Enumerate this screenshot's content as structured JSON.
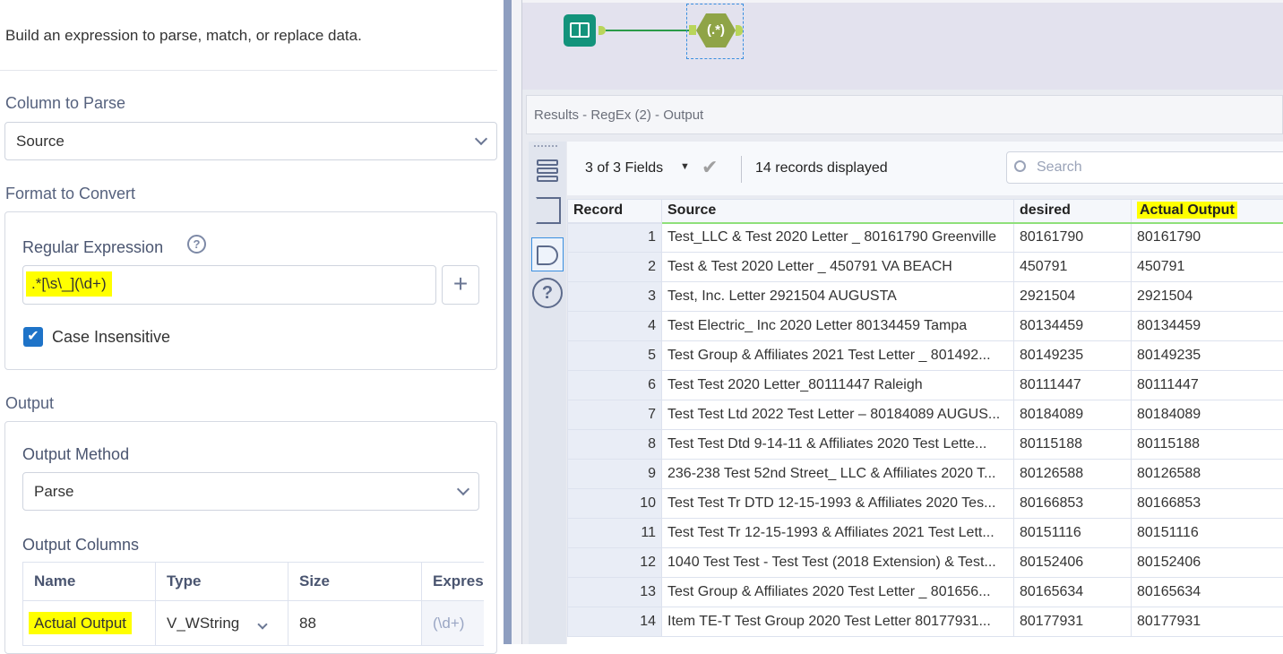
{
  "config": {
    "description": "Build an expression to parse, match, or replace data.",
    "column_to_parse_label": "Column to Parse",
    "column_to_parse_value": "Source",
    "format_label": "Format to Convert",
    "regex_label": "Regular Expression",
    "regex_value": ".*[\\s\\_](\\d+)",
    "plus_label": "+",
    "case_insensitive_label": "Case Insensitive",
    "case_insensitive_checked": true,
    "output_label": "Output",
    "output_method_label": "Output Method",
    "output_method_value": "Parse",
    "output_columns_label": "Output Columns",
    "output_columns_headers": [
      "Name",
      "Type",
      "Size",
      "Expres"
    ],
    "output_columns_rows": [
      {
        "name": "Actual Output",
        "type": "V_WString",
        "size": "88",
        "expr": "(\\d+)"
      }
    ]
  },
  "workflow": {
    "tool_regex_label": "(.*)"
  },
  "results": {
    "title": "Results - RegEx (2) - Output",
    "fields_label": "3 of 3 Fields",
    "records_label": "14 records displayed",
    "search_placeholder": "Search",
    "headers": [
      "Record",
      "Source",
      "desired",
      "Actual Output"
    ],
    "rows": [
      [
        "1",
        "Test_LLC & Test 2020 Letter _ 80161790 Greenville",
        "80161790",
        "80161790"
      ],
      [
        "2",
        "Test & Test 2020 Letter _ 450791 VA BEACH",
        "450791",
        "450791"
      ],
      [
        "3",
        "Test, Inc. Letter 2921504 AUGUSTA",
        "2921504",
        "2921504"
      ],
      [
        "4",
        "Test Electric_ Inc 2020 Letter 80134459 Tampa",
        "80134459",
        "80134459"
      ],
      [
        "5",
        "Test Group & Affiliates 2021 Test Letter _  801492...",
        "80149235",
        "80149235"
      ],
      [
        "6",
        "Test Test 2020 Letter_80111447 Raleigh",
        "80111447",
        "80111447"
      ],
      [
        "7",
        "Test Test Ltd 2022 Test Letter – 80184089 AUGUS...",
        "80184089",
        "80184089"
      ],
      [
        "8",
        "Test Test Dtd 9-14-11 & Affiliates 2020 Test Lette...",
        "80115188",
        "80115188"
      ],
      [
        "9",
        "236-238 Test 52nd Street_ LLC & Affiliates 2020 T...",
        "80126588",
        "80126588"
      ],
      [
        "10",
        "Test Test Tr DTD 12-15-1993 & Affiliates 2020 Tes...",
        "80166853",
        "80166853"
      ],
      [
        "11",
        "Test Test Tr 12-15-1993 & Affiliates 2021 Test Lett...",
        "80151116",
        "80151116"
      ],
      [
        "12",
        "1040 Test Test - Test Test (2018 Extension) & Test...",
        "80152406",
        "80152406"
      ],
      [
        "13",
        "Test Group & Affiliates 2020 Test Letter _ 801656...",
        "80165634",
        "80165634"
      ],
      [
        "14",
        "Item TE-T Test Group 2020 Test Letter 80177931...",
        "80177931",
        "80177931"
      ]
    ]
  }
}
